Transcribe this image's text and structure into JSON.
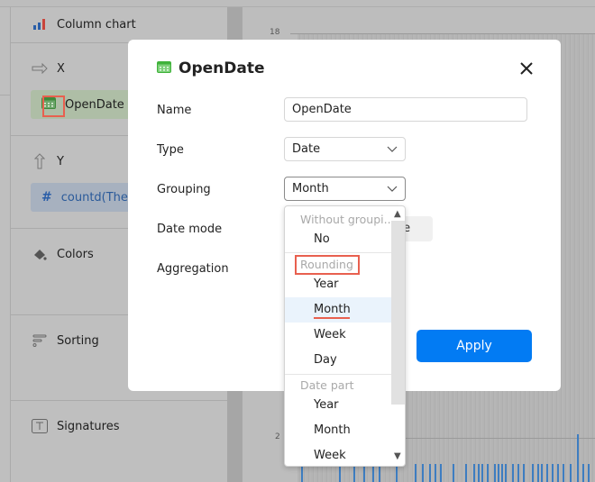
{
  "sidebar": {
    "chart_type": {
      "label": "Column chart",
      "icon": "column-chart-icon",
      "colors": [
        "#2a6fd6",
        "#2a6fd6",
        "#e2453c"
      ]
    },
    "sections": [
      {
        "id": "x",
        "label": "X",
        "icon": "arrow-right-icon",
        "chips": [
          {
            "label": "OpenDate",
            "icon": "calendar-icon",
            "highlighted": true
          }
        ]
      },
      {
        "id": "y",
        "label": "Y",
        "icon": "arrow-up-icon",
        "chips": [
          {
            "label": "countd(The",
            "icon": "hash-icon"
          }
        ]
      },
      {
        "id": "colors",
        "label": "Colors",
        "icon": "paint-bucket-icon"
      },
      {
        "id": "sorting",
        "label": "Sorting",
        "icon": "sort-icon"
      },
      {
        "id": "signatures",
        "label": "Signatures",
        "icon": "text-box-icon"
      }
    ]
  },
  "chart": {
    "y_ticks": [
      "18",
      "2"
    ],
    "bar_color": "#3d7dc1"
  },
  "modal": {
    "title": "OpenDate",
    "title_icon": "calendar-icon",
    "close_icon": "close-icon",
    "fields": {
      "name": {
        "label": "Name",
        "value": "OpenDate"
      },
      "type": {
        "label": "Type",
        "value": "Date"
      },
      "grouping": {
        "label": "Grouping",
        "value": "Month"
      },
      "date_mode": {
        "label": "Date mode",
        "value_partial": "ete"
      },
      "aggregation": {
        "label": "Aggregation"
      }
    },
    "apply_label": "Apply",
    "accent": "#027bf3"
  },
  "dropdown": {
    "groups": [
      {
        "label": "Without groupi...",
        "items": [
          "No"
        ]
      },
      {
        "label": "Rounding",
        "items": [
          "Year",
          "Month",
          "Week",
          "Day"
        ],
        "highlighted": true
      },
      {
        "label": "Date part",
        "items": [
          "Year",
          "Month",
          "Week"
        ]
      }
    ],
    "selected": "Month",
    "highlight_color": "#e8604f"
  }
}
